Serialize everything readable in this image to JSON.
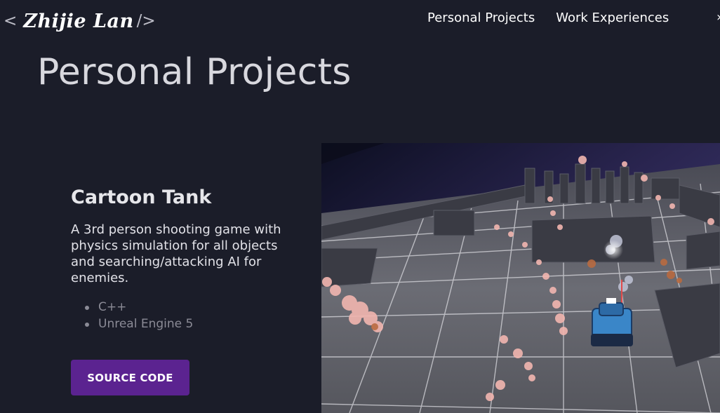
{
  "header": {
    "brand_open": "<",
    "brand_name": "Zhijie Lan",
    "brand_close": "/>",
    "nav": [
      {
        "label": "Personal Projects"
      },
      {
        "label": "Work Experiences"
      }
    ]
  },
  "page_title": "Personal Projects",
  "project": {
    "title": "Cartoon Tank",
    "description": "A 3rd person shooting game with physics simulation for all objects and searching/attacking AI for enemies.",
    "tags": [
      "C++",
      "Unreal Engine 5"
    ],
    "button_label": "SOURCE CODE",
    "screenshot_alt": "Cartoon Tank gameplay screenshot"
  },
  "colors": {
    "background": "#1b1d29",
    "button": "#5b2390",
    "tank": "#3a86c8",
    "smoke": "#f2b6b0"
  }
}
